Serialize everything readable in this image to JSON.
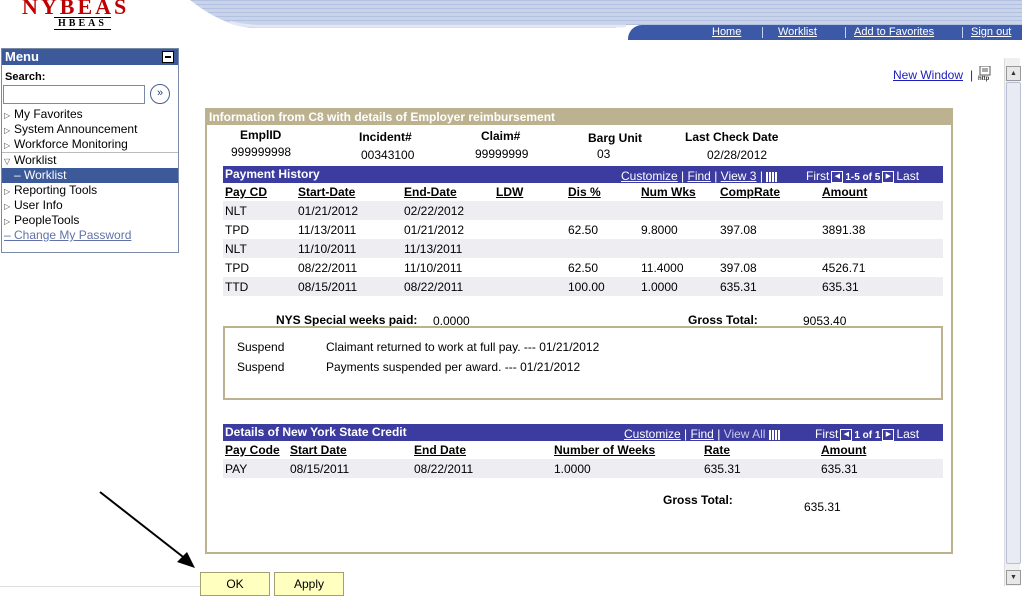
{
  "logo": {
    "main": "NYBEAS",
    "sub": "HBEAS"
  },
  "topnav": [
    "Home",
    "Worklist",
    "Add to Favorites",
    "Sign out"
  ],
  "menu": {
    "title": "Menu",
    "search_label": "Search:",
    "go_glyph": "»",
    "items": [
      "My Favorites",
      "System Announcement",
      "Workforce Monitoring",
      "Worklist"
    ],
    "sub_item": "– Worklist",
    "items2": [
      "Reporting Tools",
      "User Info",
      "PeopleTools"
    ],
    "change_password": "– Change My Password"
  },
  "new_window": "New Window",
  "http_icon": "http",
  "panel": {
    "title": "Information from C8 with details of Employer reimbursement",
    "fields": [
      {
        "label": "EmplID",
        "value": "999999998"
      },
      {
        "label": "Incident#",
        "value": "00343100"
      },
      {
        "label": "Claim#",
        "value": "99999999"
      },
      {
        "label": "Barg Unit",
        "value": "03"
      },
      {
        "label": "Last Check Date",
        "value": "02/28/2012"
      }
    ]
  },
  "payment_history": {
    "title": "Payment History",
    "nav": {
      "customize": "Customize",
      "find": "Find",
      "view": "View 3",
      "first": "First",
      "range": "1-5 of 5",
      "last": "Last"
    },
    "columns": [
      "Pay CD",
      "Start-Date",
      "End-Date",
      "LDW",
      "Dis %",
      "Num Wks",
      "CompRate",
      "Amount"
    ],
    "rows": [
      [
        "NLT",
        "01/21/2012",
        "02/22/2012",
        "",
        "",
        "",
        "",
        ""
      ],
      [
        "TPD",
        "11/13/2011",
        "01/21/2012",
        "",
        "62.50",
        "9.8000",
        "397.08",
        "3891.38"
      ],
      [
        "NLT",
        "11/10/2011",
        "11/13/2011",
        "",
        "",
        "",
        "",
        ""
      ],
      [
        "TPD",
        "08/22/2011",
        "11/10/2011",
        "",
        "62.50",
        "11.4000",
        "397.08",
        "4526.71"
      ],
      [
        "TTD",
        "08/15/2011",
        "08/22/2011",
        "",
        "100.00",
        "1.0000",
        "635.31",
        "635.31"
      ]
    ]
  },
  "summary": {
    "special_label": "NYS Special weeks paid:",
    "special_value": "0.0000",
    "gross_label": "Gross Total:",
    "gross_value": "9053.40"
  },
  "notes": [
    {
      "type": "Suspend",
      "text": "Claimant returned to work at full pay. --- 01/21/2012"
    },
    {
      "type": "Suspend",
      "text": "Payments suspended per award. --- 01/21/2012"
    }
  ],
  "credit": {
    "title": "Details of New York State Credit",
    "nav": {
      "customize": "Customize",
      "find": "Find",
      "view": "View All",
      "first": "First",
      "range": "1 of 1",
      "last": "Last"
    },
    "columns": [
      "Pay Code",
      "Start Date",
      "End Date",
      "Number of Weeks",
      "Rate",
      "Amount"
    ],
    "rows": [
      [
        "PAY",
        "08/15/2011",
        "08/22/2011",
        "1.0000",
        "635.31",
        "635.31"
      ]
    ],
    "gross_label": "Gross Total:",
    "gross_value": "635.31"
  },
  "buttons": {
    "ok": "OK",
    "apply": "Apply"
  }
}
